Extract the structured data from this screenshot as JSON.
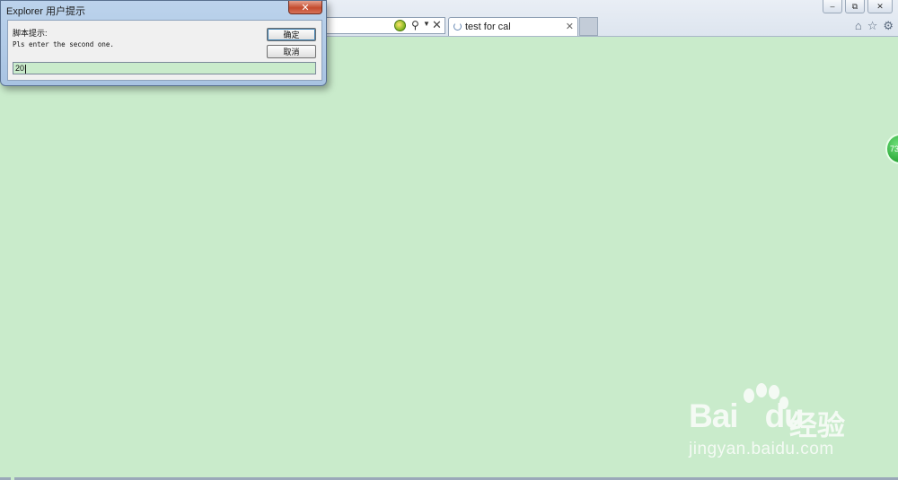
{
  "browser": {
    "tab_title": "test for cal",
    "window_controls": [
      "minimize-icon",
      "restore-icon",
      "close-icon"
    ],
    "toolbar_icons": [
      "home-icon",
      "star-icon",
      "gear-icon"
    ]
  },
  "dialog": {
    "title": "Explorer 用户提示",
    "prompt_title": "脚本提示:",
    "message": "Pls enter the second one.",
    "ok_label": "确定",
    "cancel_label": "取消",
    "input_value": "20"
  },
  "page": {
    "side_badge": "73",
    "watermark_brand": "Bai",
    "watermark_brand2": "du",
    "watermark_cn": "经验",
    "watermark_url": "jingyan.baidu.com"
  },
  "colors": {
    "page_background": "#c9ebcb",
    "dialog_frame": "#a8c3e2",
    "close_button": "#c44b2e"
  }
}
